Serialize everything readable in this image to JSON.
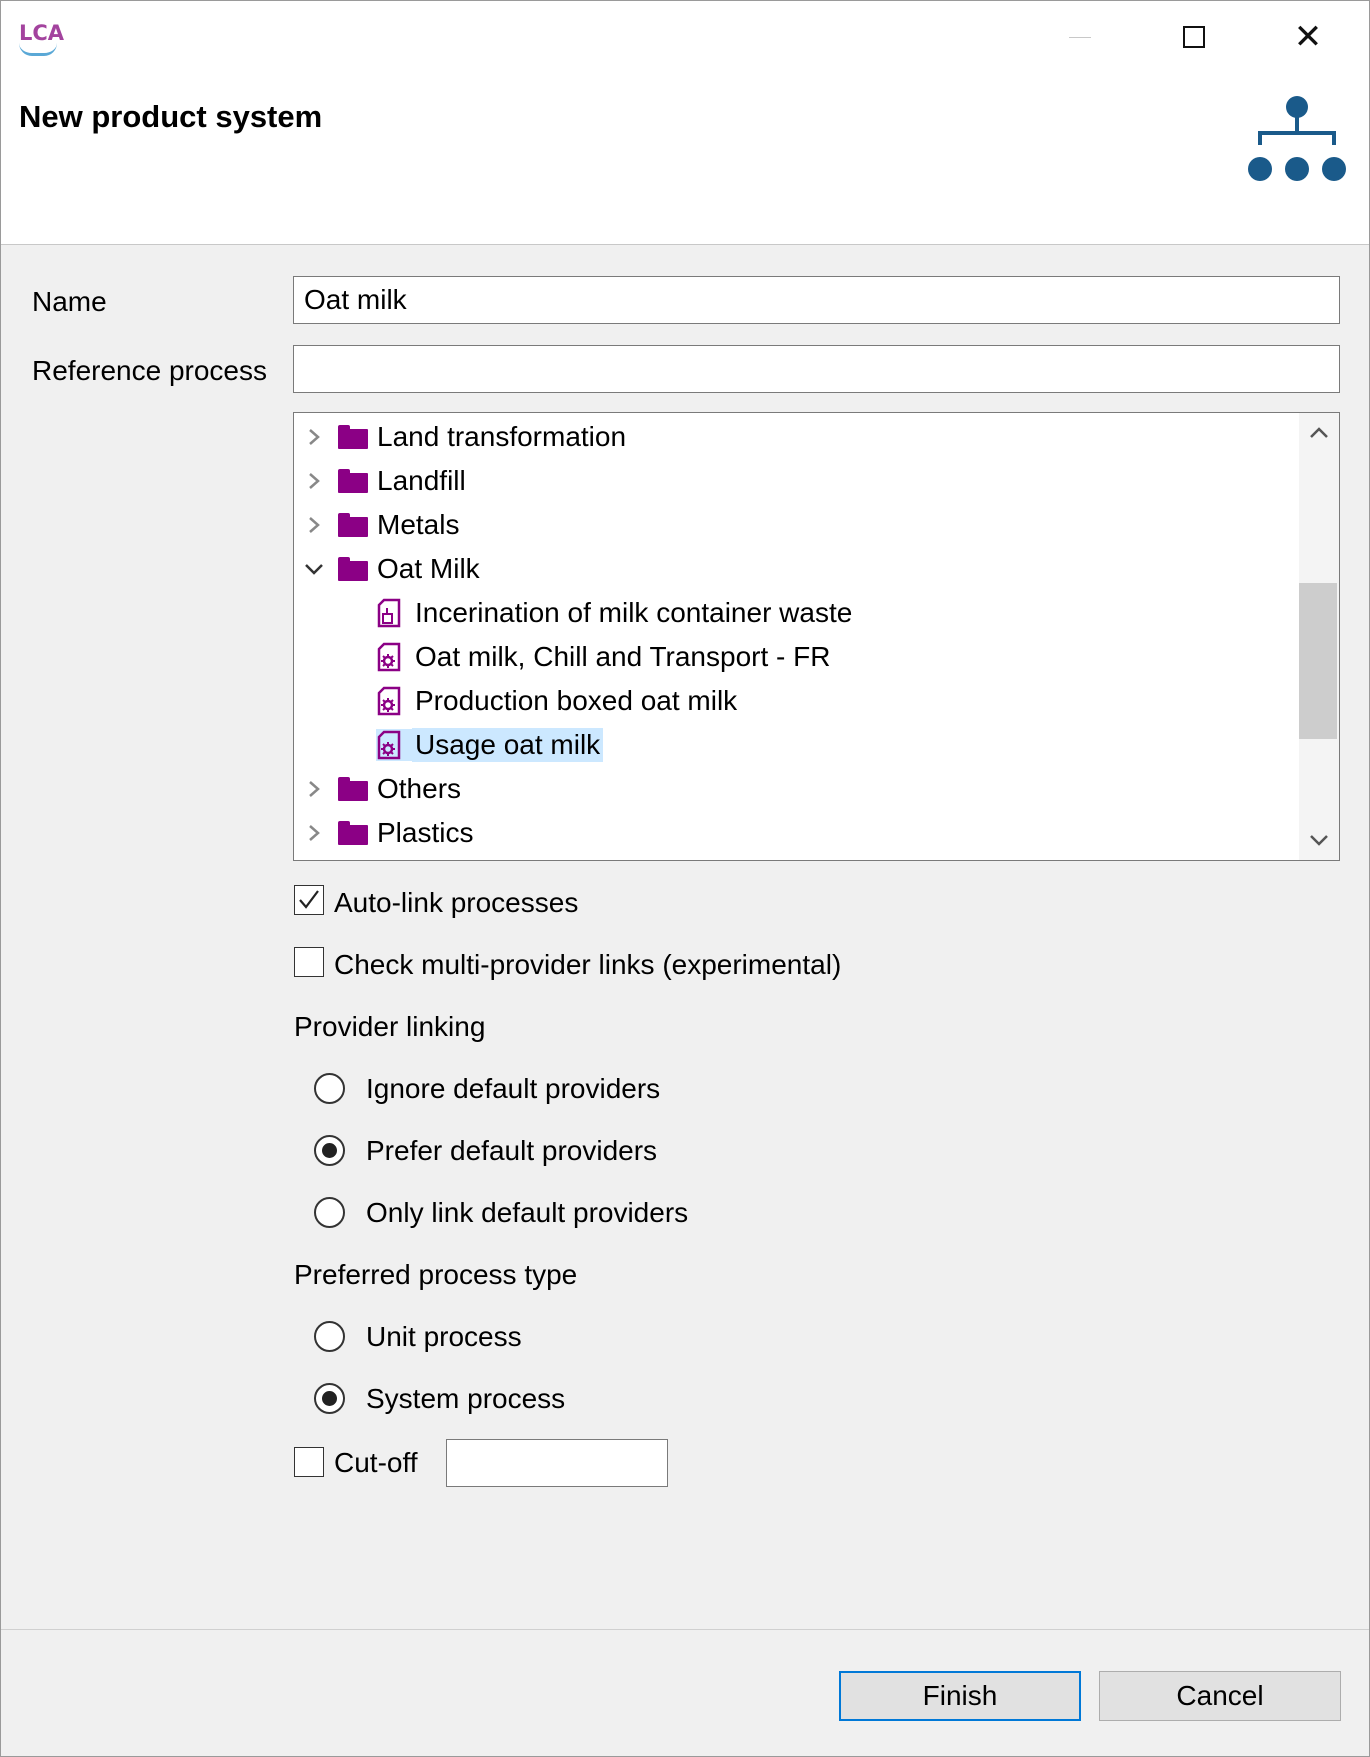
{
  "window": {
    "logo_text": "LCA",
    "title": "New product system",
    "controls": {
      "minimize": "minimize-icon",
      "maximize": "maximize-icon",
      "close": "close-icon"
    }
  },
  "form": {
    "name_label": "Name",
    "name_value": "Oat milk",
    "ref_label": "Reference process",
    "ref_value": ""
  },
  "tree": {
    "items": [
      {
        "label": "Land transformation",
        "type": "folder",
        "expanded": false
      },
      {
        "label": "Landfill",
        "type": "folder",
        "expanded": false
      },
      {
        "label": "Metals",
        "type": "folder",
        "expanded": false
      },
      {
        "label": "Oat Milk",
        "type": "folder",
        "expanded": true
      },
      {
        "label": "Incerination of milk container waste",
        "type": "process",
        "selected": false
      },
      {
        "label": "Oat milk, Chill and Transport - FR",
        "type": "process",
        "selected": false
      },
      {
        "label": "Production boxed oat milk",
        "type": "process",
        "selected": false
      },
      {
        "label": "Usage oat milk",
        "type": "process",
        "selected": true
      },
      {
        "label": "Others",
        "type": "folder",
        "expanded": false
      },
      {
        "label": "Plastics",
        "type": "folder",
        "expanded": false
      }
    ]
  },
  "options": {
    "autolink_label": "Auto-link processes",
    "autolink_checked": true,
    "multiprov_label": "Check multi-provider links (experimental)",
    "multiprov_checked": false,
    "provider_linking_label": "Provider linking",
    "provider_options": [
      {
        "label": "Ignore default providers",
        "selected": false
      },
      {
        "label": "Prefer default providers",
        "selected": true
      },
      {
        "label": "Only link default providers",
        "selected": false
      }
    ],
    "process_type_label": "Preferred process type",
    "process_types": [
      {
        "label": "Unit process",
        "selected": false
      },
      {
        "label": "System process",
        "selected": true
      }
    ],
    "cutoff_label": "Cut-off",
    "cutoff_checked": false,
    "cutoff_value": ""
  },
  "buttons": {
    "finish": "Finish",
    "cancel": "Cancel"
  },
  "colors": {
    "folder": "#8b0085",
    "accent": "#0078d7",
    "selection": "#cce8ff",
    "icon_blue": "#1a5a8a"
  }
}
